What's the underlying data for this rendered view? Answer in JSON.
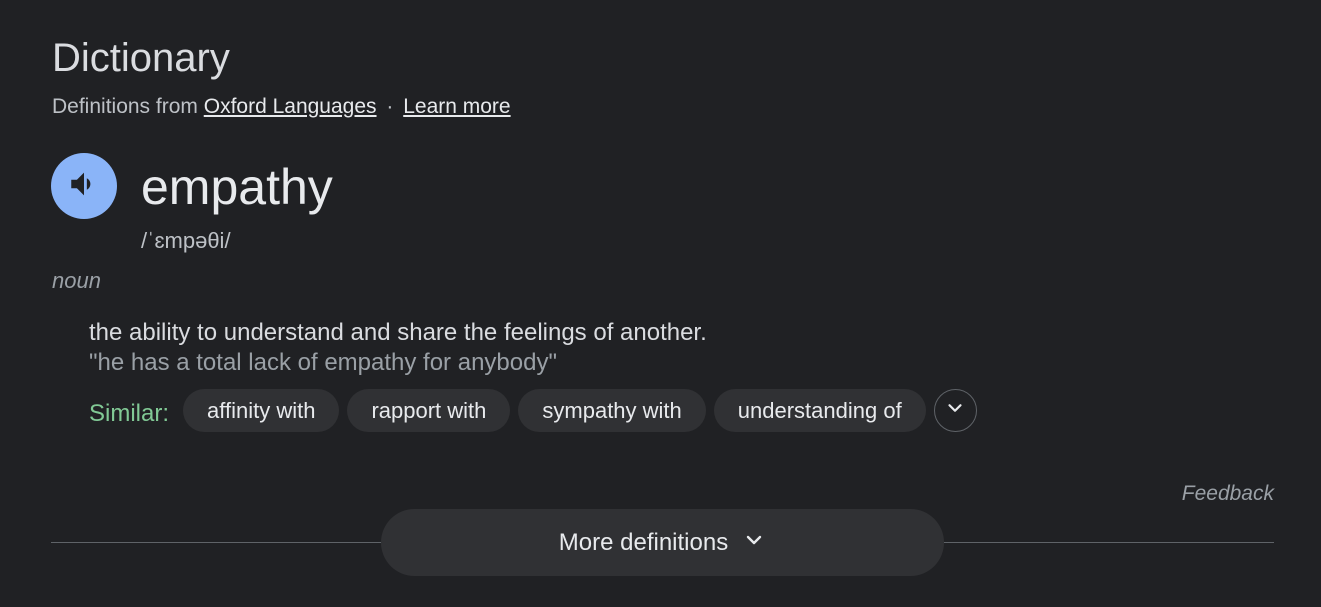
{
  "header": {
    "title": "Dictionary",
    "source_prefix": "Definitions from",
    "source_link": "Oxford Languages",
    "separator": "·",
    "learn_more": "Learn more"
  },
  "entry": {
    "word": "empathy",
    "phonetic": "/ˈɛmpəθi/",
    "part_of_speech": "noun",
    "definition": "the ability to understand and share the feelings of another.",
    "example": "\"he has a total lack of empathy for anybody\"",
    "similar_label": "Similar:",
    "similar": [
      "affinity with",
      "rapport with",
      "sympathy with",
      "understanding of"
    ]
  },
  "footer": {
    "feedback": "Feedback",
    "more_definitions": "More definitions"
  },
  "icons": {
    "speaker": "speaker-icon",
    "expand": "chevron-down-icon",
    "more": "chevron-down-icon"
  },
  "colors": {
    "background": "#202124",
    "accent": "#8ab4f8",
    "similar_label": "#81c995",
    "chip_bg": "#303134"
  }
}
